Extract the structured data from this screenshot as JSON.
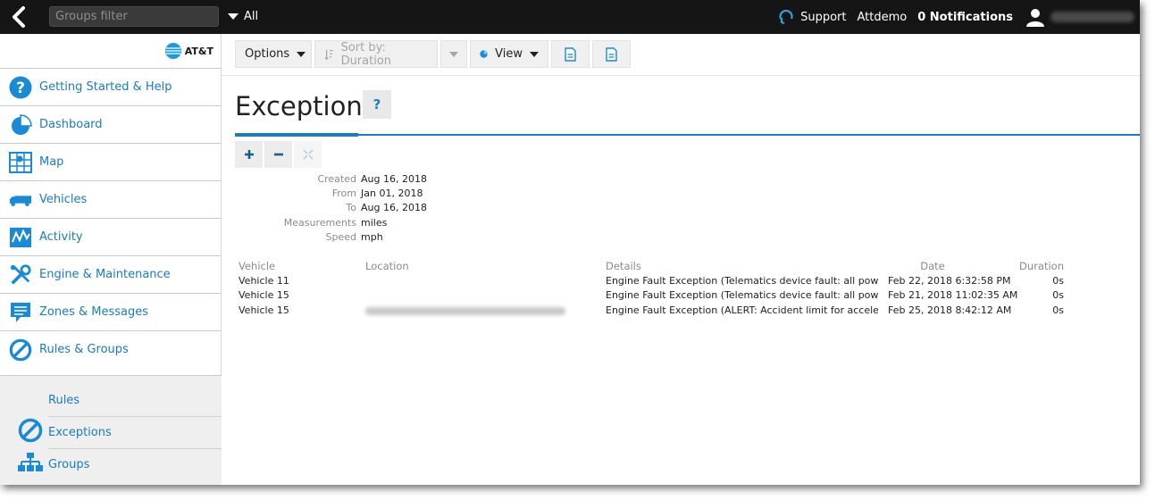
{
  "topbar": {
    "filter_placeholder": "Groups filter",
    "groups_selector": "All",
    "support_label": "Support",
    "user_name": "Attdemo",
    "notifications_label": "0 Notifications"
  },
  "sidebar": {
    "logo_text": "AT&T",
    "items": [
      {
        "label": "Getting Started & Help",
        "icon": "help-circle-icon"
      },
      {
        "label": "Dashboard",
        "icon": "pie-chart-icon"
      },
      {
        "label": "Map",
        "icon": "map-icon"
      },
      {
        "label": "Vehicles",
        "icon": "truck-icon"
      },
      {
        "label": "Activity",
        "icon": "activity-graph-icon"
      },
      {
        "label": "Engine & Maintenance",
        "icon": "tools-icon"
      },
      {
        "label": "Zones & Messages",
        "icon": "message-icon"
      },
      {
        "label": "Rules & Groups",
        "icon": "prohibited-icon"
      }
    ],
    "sub_items": [
      {
        "label": "Rules",
        "icon": ""
      },
      {
        "label": "Exceptions",
        "icon": "prohibited-icon"
      },
      {
        "label": "Groups",
        "icon": "org-chart-icon"
      }
    ]
  },
  "toolbar": {
    "options_label": "Options",
    "sort_label": "Sort by: Duration",
    "view_label": "View"
  },
  "page": {
    "title": "Exceptions",
    "help_label": "?"
  },
  "meta": [
    {
      "key": "Created",
      "value": "Aug 16, 2018"
    },
    {
      "key": "From",
      "value": "Jan 01, 2018"
    },
    {
      "key": "To",
      "value": "Aug 16, 2018"
    },
    {
      "key": "Measurements",
      "value": "miles"
    },
    {
      "key": "Speed",
      "value": "mph"
    }
  ],
  "table": {
    "headers": {
      "vehicle": "Vehicle",
      "location": "Location",
      "details": "Details",
      "date": "Date",
      "duration": "Duration"
    },
    "rows": [
      {
        "vehicle": "Vehicle 11",
        "location": "",
        "details": "Engine Fault Exception (Telematics device fault: all power remo",
        "date": "Feb 22, 2018 6:32:58 PM",
        "duration": "0s"
      },
      {
        "vehicle": "Vehicle 15",
        "location": "",
        "details": "Engine Fault Exception (Telematics device fault: all power remo",
        "date": "Feb 21, 2018 11:02:35 AM",
        "duration": "0s"
      },
      {
        "vehicle": "Vehicle 15",
        "location": "",
        "details": "Engine Fault Exception (ALERT: Accident limit for acceleration e",
        "date": "Feb 25, 2018 8:42:12 AM",
        "duration": "0s"
      }
    ]
  },
  "colors": {
    "accent": "#1a7bbf",
    "topbar_bg": "#151515",
    "sub_nav_bg": "#efefef"
  }
}
